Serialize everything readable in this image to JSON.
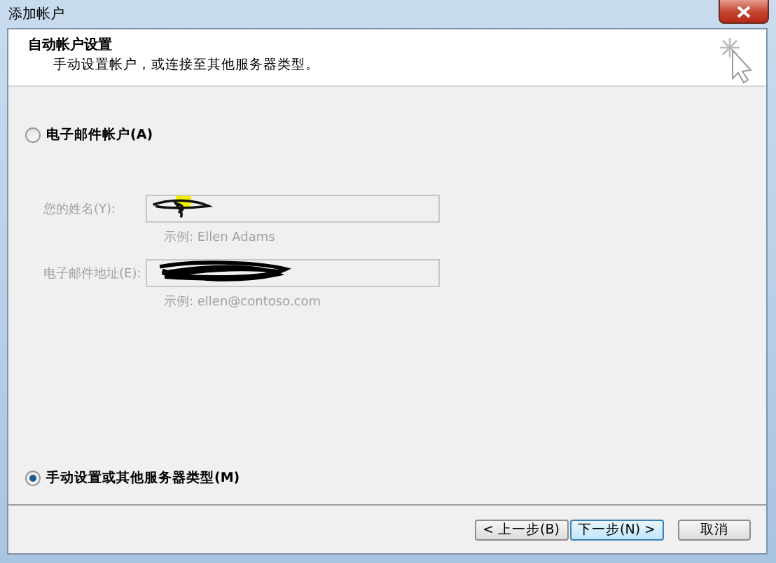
{
  "window": {
    "title": "添加帐户"
  },
  "header": {
    "title": "自动帐户设置",
    "subtitle": "手动设置帐户，或连接至其他服务器类型。"
  },
  "options": [
    {
      "label": "电子邮件帐户(A)",
      "selected": false
    },
    {
      "label": "手动设置或其他服务器类型(M)",
      "selected": true
    }
  ],
  "fields": [
    {
      "label": "您的姓名(Y):",
      "hint": "示例: Ellen Adams",
      "disabled": true,
      "redacted": true
    },
    {
      "label": "电子邮件地址(E):",
      "hint": "示例: ellen@contoso.com",
      "disabled": true,
      "redacted": true
    }
  ],
  "buttons": [
    {
      "label": "< 上一步(B)",
      "focused": false
    },
    {
      "label": "下一步(N) >",
      "focused": true
    },
    {
      "label": "取消",
      "focused": false
    }
  ]
}
